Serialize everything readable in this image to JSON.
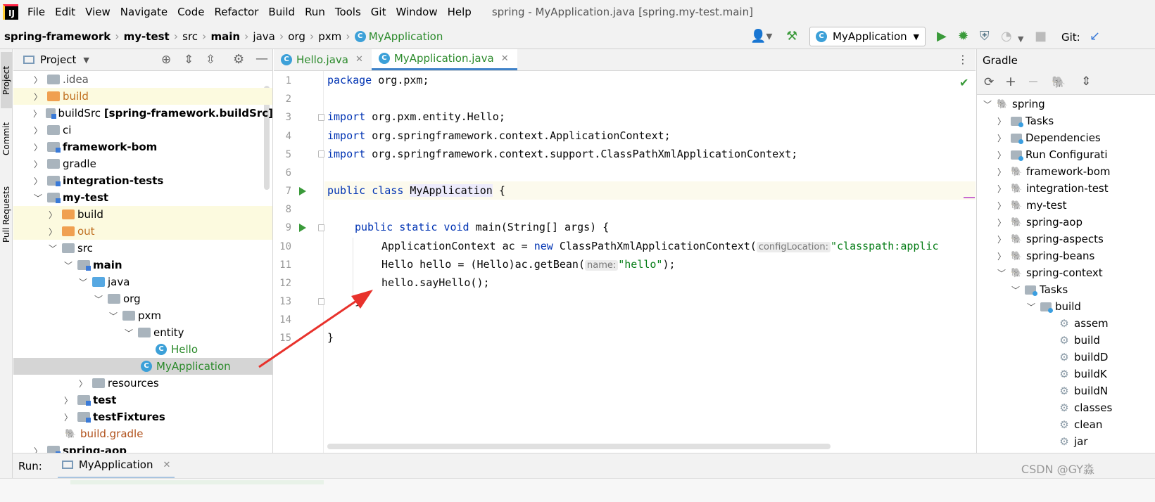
{
  "menu": {
    "items": [
      "File",
      "Edit",
      "View",
      "Navigate",
      "Code",
      "Refactor",
      "Build",
      "Run",
      "Tools",
      "Git",
      "Window",
      "Help"
    ],
    "window_title": "spring - MyApplication.java [spring.my-test.main]"
  },
  "breadcrumb": {
    "items": [
      "spring-framework",
      "my-test",
      "src",
      "main",
      "java",
      "org",
      "pxm",
      "MyApplication"
    ],
    "git_label": "Git:"
  },
  "run_config": {
    "selected": "MyApplication"
  },
  "left_strip": {
    "tabs": [
      "Project",
      "Commit",
      "Pull Requests"
    ]
  },
  "project_panel": {
    "title": "Project",
    "rows": [
      {
        "label": ".idea",
        "suffix": ""
      },
      {
        "label": "build",
        "suffix": ""
      },
      {
        "label": "buildSrc",
        "suffix": "[spring-framework.buildSrc]"
      },
      {
        "label": "ci",
        "suffix": ""
      },
      {
        "label": "framework-bom",
        "suffix": ""
      },
      {
        "label": "gradle",
        "suffix": ""
      },
      {
        "label": "integration-tests",
        "suffix": ""
      },
      {
        "label": "my-test",
        "suffix": ""
      },
      {
        "label": "build",
        "suffix": ""
      },
      {
        "label": "out",
        "suffix": ""
      },
      {
        "label": "src",
        "suffix": ""
      },
      {
        "label": "main",
        "suffix": ""
      },
      {
        "label": "java",
        "suffix": ""
      },
      {
        "label": "org",
        "suffix": ""
      },
      {
        "label": "pxm",
        "suffix": ""
      },
      {
        "label": "entity",
        "suffix": ""
      },
      {
        "label": "Hello",
        "suffix": ""
      },
      {
        "label": "MyApplication",
        "suffix": ""
      },
      {
        "label": "resources",
        "suffix": ""
      },
      {
        "label": "test",
        "suffix": ""
      },
      {
        "label": "testFixtures",
        "suffix": ""
      },
      {
        "label": "build.gradle",
        "suffix": ""
      },
      {
        "label": "spring-aop",
        "suffix": ""
      }
    ]
  },
  "editor": {
    "tabs": [
      {
        "label": "Hello.java",
        "icon": "C"
      },
      {
        "label": "MyApplication.java",
        "icon": "C"
      }
    ],
    "line_numbers": [
      "1",
      "2",
      "3",
      "4",
      "5",
      "6",
      "7",
      "8",
      "9",
      "10",
      "11",
      "12",
      "13",
      "14",
      "15"
    ],
    "lines": {
      "l1_kw": "package",
      "l1_rest": " org.pxm;",
      "l3_kw": "import",
      "l3_rest": " org.pxm.entity.Hello;",
      "l4_kw": "import",
      "l4_rest": " org.springframework.context.ApplicationContext;",
      "l5_kw": "import",
      "l5_rest": " org.springframework.context.support.ClassPathXmlApplicationContext;",
      "l7_kw": "public class",
      "l7_name": "MyApplication",
      "l7_rest": " {",
      "l9_kw": "public static void",
      "l9_rest": " main(String[] args) {",
      "l10_a": "ApplicationContext ac = ",
      "l10_kw": "new",
      "l10_b": " ClassPathXmlApplicationContext(",
      "l10_hint": "configLocation:",
      "l10_str": "\"classpath:applic",
      "l11_a": "Hello hello = (Hello)ac.getBean(",
      "l11_hint": "name:",
      "l11_str": "\"hello\"",
      "l11_b": ");",
      "l12": "hello.sayHello();",
      "l13": "}",
      "l15": "}"
    }
  },
  "gradle_panel": {
    "title": "Gradle",
    "rows": [
      "spring",
      "Tasks",
      "Dependencies",
      "Run Configurati",
      "framework-bom",
      "integration-test",
      "my-test",
      "spring-aop",
      "spring-aspects",
      "spring-beans",
      "spring-context",
      "Tasks",
      "build",
      "assem",
      "build",
      "buildD",
      "buildK",
      "buildN",
      "classes",
      "clean",
      "jar"
    ]
  },
  "bottom": {
    "run_label": "Run:",
    "run_tab": "MyApplication",
    "watermark": "CSDN @GY淼"
  },
  "colors": {
    "keyword": "#0033b3",
    "string": "#067d17",
    "class_green": "#2b8a2b",
    "arrow": "#e8322c"
  }
}
